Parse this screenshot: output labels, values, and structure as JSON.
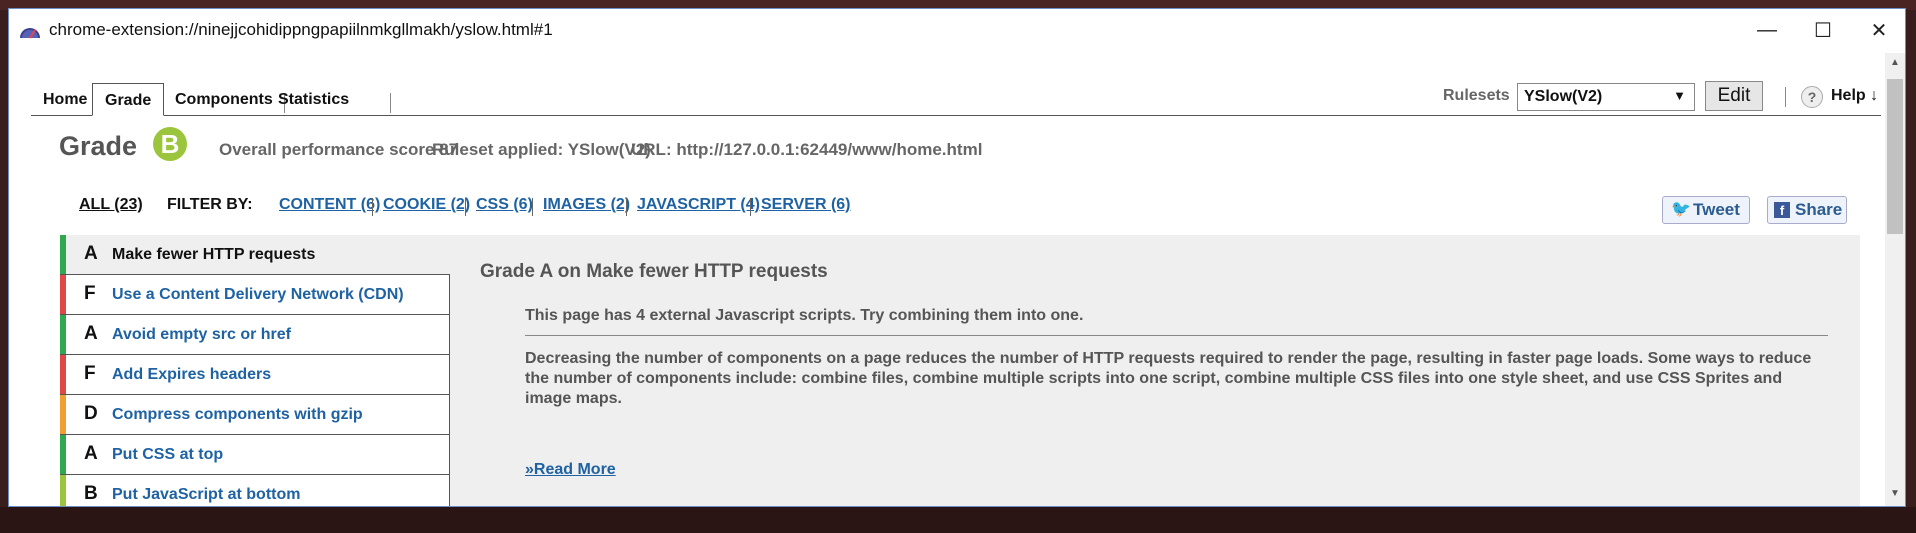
{
  "window": {
    "title": "chrome-extension://ninejjcohidippngpapiilnmkgllmakh/yslow.html#1",
    "min_glyph": "—",
    "max_glyph": "☐",
    "close_glyph": "✕"
  },
  "tabs": [
    {
      "label": "Home",
      "active": false
    },
    {
      "label": "Grade",
      "active": true
    },
    {
      "label": "Components",
      "active": false
    },
    {
      "label": "Statistics",
      "active": false
    }
  ],
  "toolbar": {
    "rulesets_label": "Rulesets",
    "ruleset_value": "YSlow(V2)",
    "edit_label": "Edit",
    "help_icon": "?",
    "help_label": "Help ↓"
  },
  "grade": {
    "label": "Grade",
    "letter": "B",
    "badge_color": "#9bc53d",
    "overall_score": "Overall performance score 87",
    "ruleset_applied": "Ruleset applied: YSlow(V2)",
    "url": "URL: http://127.0.0.1:62449/www/home.html"
  },
  "filters": {
    "all": "ALL (23)",
    "filter_by": "FILTER BY:",
    "items": [
      "CONTENT (6)",
      "COOKIE (2)",
      "CSS (6)",
      "IMAGES (2)",
      "JAVASCRIPT (4)",
      "SERVER (6)"
    ]
  },
  "social": {
    "tweet_icon": "twitter-icon",
    "tweet_label": "Tweet",
    "share_icon": "facebook-icon",
    "share_label": "Share"
  },
  "rules": [
    {
      "grade": "A",
      "name": "Make fewer HTTP requests",
      "color": "#2fa84f"
    },
    {
      "grade": "F",
      "name": "Use a Content Delivery Network (CDN)",
      "color": "#e04848"
    },
    {
      "grade": "A",
      "name": "Avoid empty src or href",
      "color": "#2fa84f"
    },
    {
      "grade": "F",
      "name": "Add Expires headers",
      "color": "#e04848"
    },
    {
      "grade": "D",
      "name": "Compress components with gzip",
      "color": "#f0a030"
    },
    {
      "grade": "A",
      "name": "Put CSS at top",
      "color": "#2fa84f"
    },
    {
      "grade": "B",
      "name": "Put JavaScript at bottom",
      "color": "#9bc53d"
    }
  ],
  "detail": {
    "title": "Grade A on Make fewer HTTP requests",
    "summary": "This page has 4 external Javascript scripts. Try combining them into one.",
    "description": "Decreasing the number of components on a page reduces the number of HTTP requests required to render the page, resulting in faster page loads. Some ways to reduce the number of components include: combine files, combine multiple scripts into one script, combine multiple CSS files into one style sheet, and use CSS Sprites and image maps.",
    "read_more": "»Read More"
  }
}
